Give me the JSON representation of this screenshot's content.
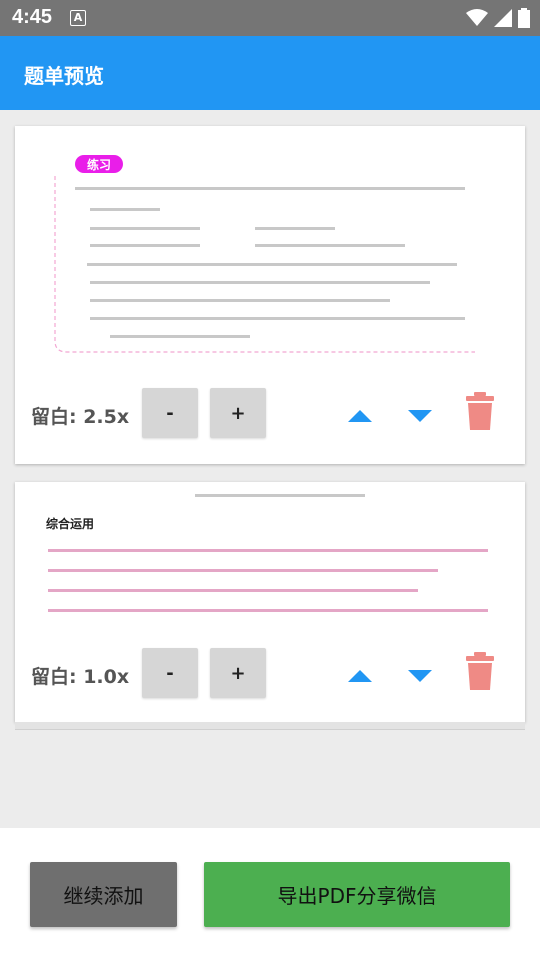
{
  "status_bar": {
    "time": "4:45",
    "notification_glyph": "A"
  },
  "app_bar": {
    "title": "题单预览"
  },
  "cards": [
    {
      "tag": "练习",
      "margin_label": "留白: 2.5x",
      "minus_label": "-",
      "plus_label": "+"
    },
    {
      "section_title": "综合运用",
      "margin_label": "留白: 1.0x",
      "minus_label": "-",
      "plus_label": "+"
    }
  ],
  "bottom": {
    "continue_label": "继续添加",
    "export_label": "导出PDF分享微信"
  },
  "colors": {
    "app_bar": "#2196f3",
    "arrow": "#2196f3",
    "trash": "#ef8a85",
    "export_button": "#4caf50",
    "continue_button": "#6f6f6f",
    "tag": "#e91ee9"
  }
}
